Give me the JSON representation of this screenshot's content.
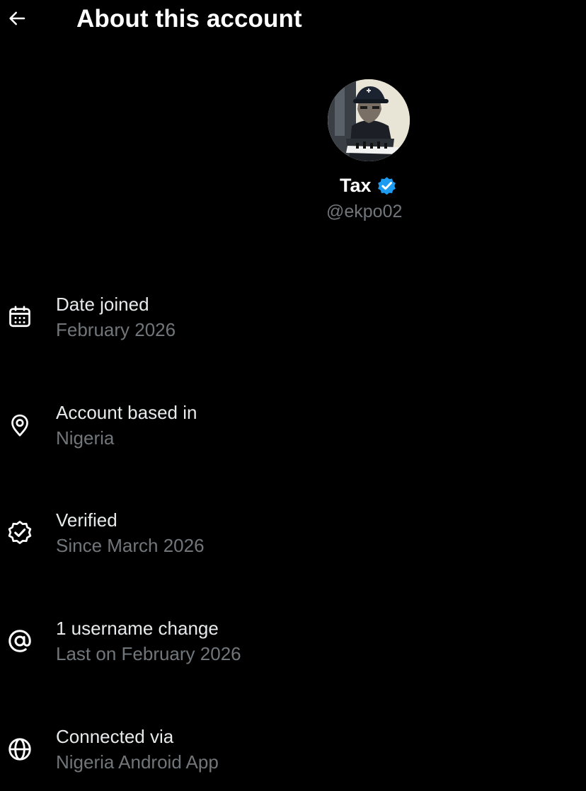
{
  "header": {
    "title": "About this account",
    "back_icon": "arrow-left-icon"
  },
  "profile": {
    "avatar_icon": "profile-avatar",
    "display_name": "Tax",
    "verified_icon": "verified-badge-icon",
    "verified_color": "#1d9bf0",
    "handle": "@ekpo02"
  },
  "details": [
    {
      "icon": "calendar-icon",
      "label": "Date joined",
      "value": "February 2026"
    },
    {
      "icon": "location-pin-icon",
      "label": "Account based in",
      "value": "Nigeria"
    },
    {
      "icon": "verified-check-icon",
      "label": "Verified",
      "value": "Since March 2026"
    },
    {
      "icon": "at-sign-icon",
      "label": "1 username change",
      "value": "Last on February 2026"
    },
    {
      "icon": "globe-icon",
      "label": "Connected via",
      "value": "Nigeria Android App"
    }
  ],
  "colors": {
    "background": "#000000",
    "primary_text": "#e7e9ea",
    "secondary_text": "#71767b",
    "accent": "#1d9bf0"
  }
}
